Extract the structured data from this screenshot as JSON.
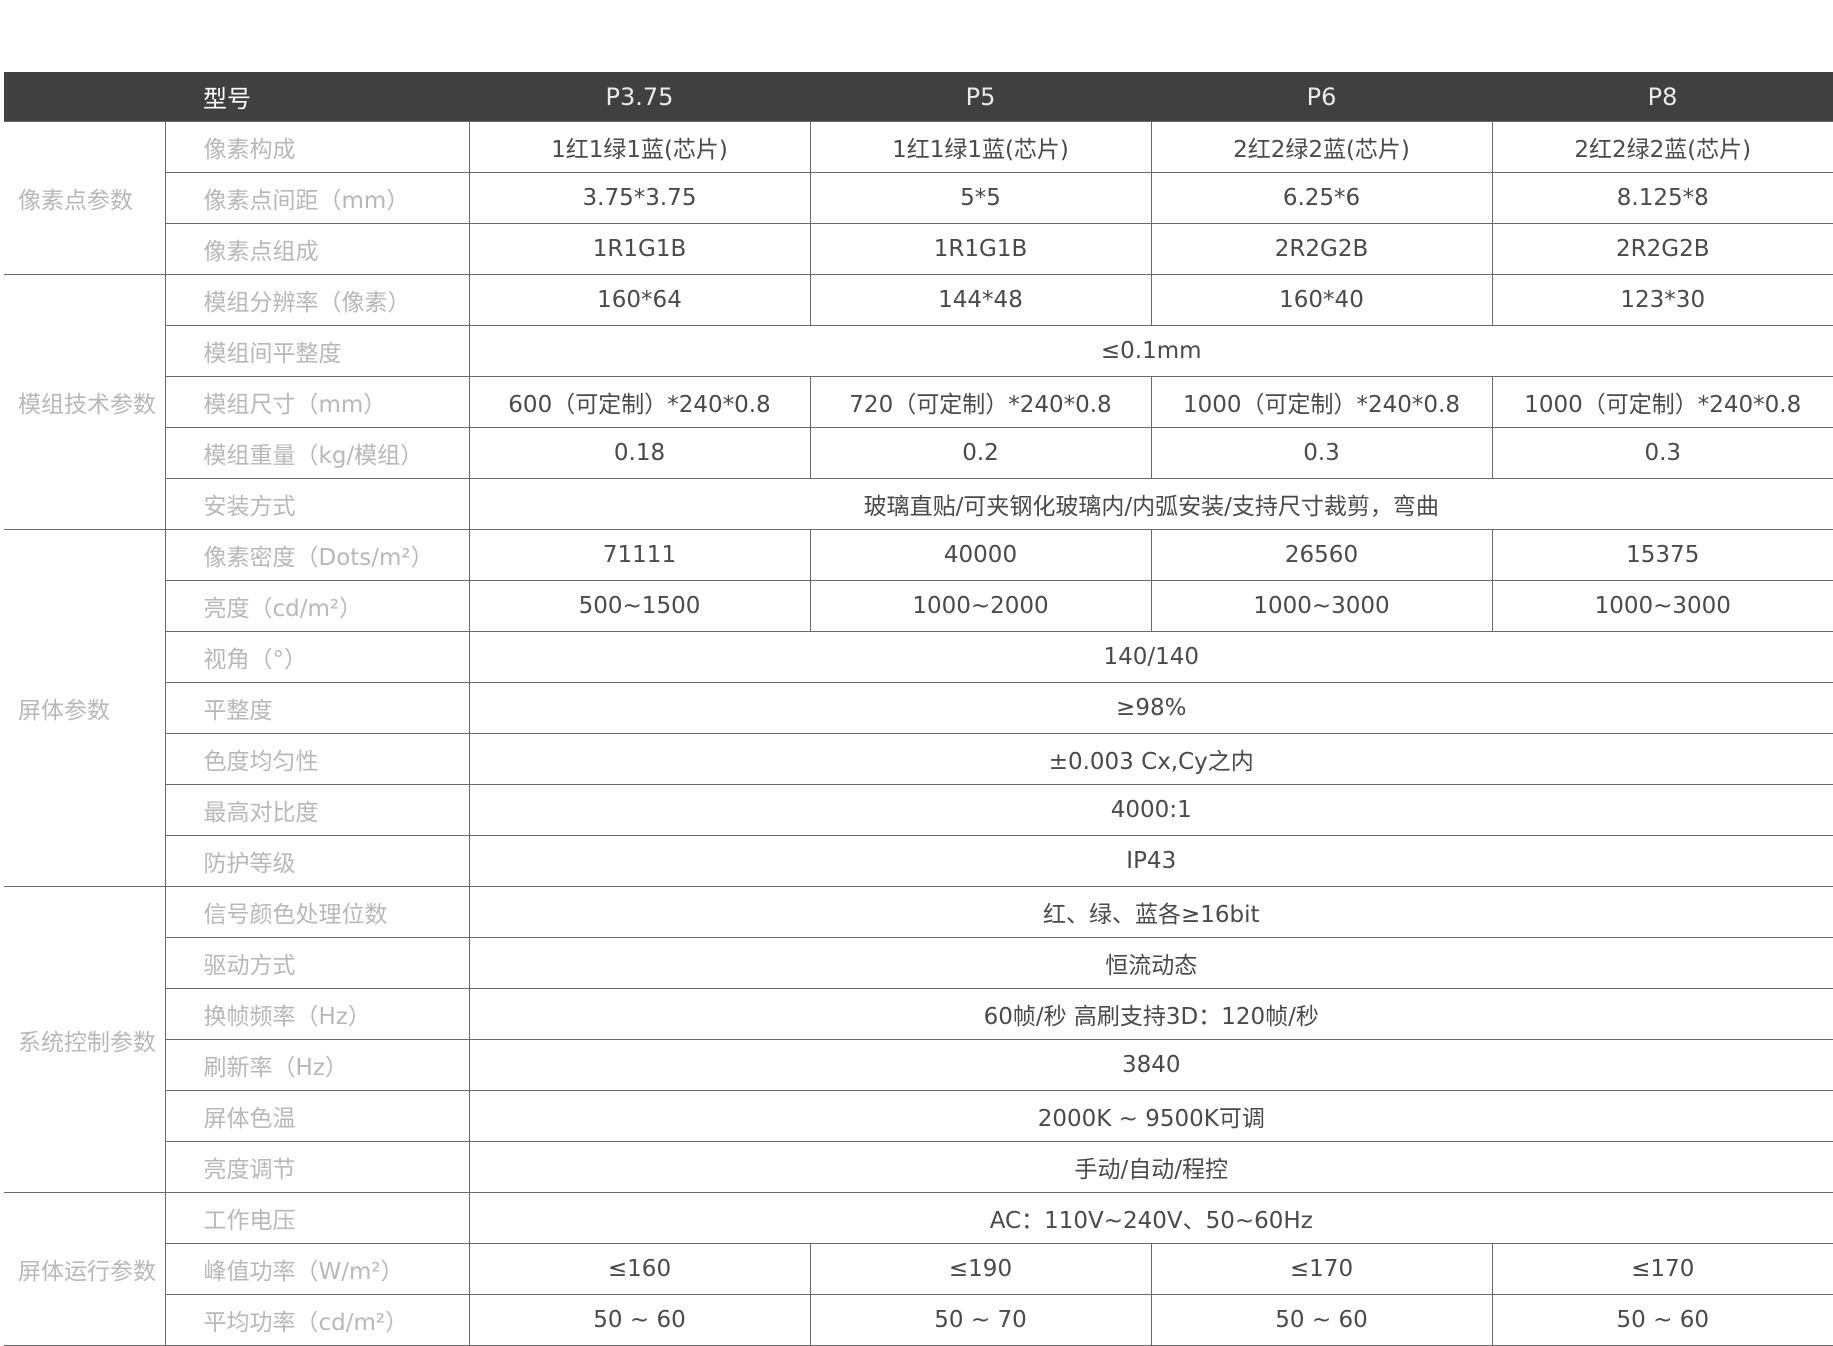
{
  "header": {
    "model_label": "型号",
    "models": [
      "P3.75",
      "P5",
      "P6",
      "P8"
    ]
  },
  "groups": [
    {
      "name": "像素点参数",
      "rows": [
        {
          "param": "像素构成",
          "values": [
            "1红1绿1蓝(芯片)",
            "1红1绿1蓝(芯片)",
            "2红2绿2蓝(芯片)",
            "2红2绿2蓝(芯片)"
          ]
        },
        {
          "param": "像素点间距（mm）",
          "values": [
            "3.75*3.75",
            "5*5",
            "6.25*6",
            "8.125*8"
          ]
        },
        {
          "param": "像素点组成",
          "values": [
            "1R1G1B",
            "1R1G1B",
            "2R2G2B",
            "2R2G2B"
          ]
        }
      ]
    },
    {
      "name": "模组技术参数",
      "rows": [
        {
          "param": "模组分辨率（像素）",
          "values": [
            "160*64",
            "144*48",
            "160*40",
            "123*30"
          ]
        },
        {
          "param": "模组间平整度",
          "merged": "≤0.1mm"
        },
        {
          "param": "模组尺寸（mm）",
          "values": [
            "600（可定制）*240*0.8",
            "720（可定制）*240*0.8",
            "1000（可定制）*240*0.8",
            "1000（可定制）*240*0.8"
          ]
        },
        {
          "param": "模组重量（kg/模组）",
          "values": [
            "0.18",
            "0.2",
            "0.3",
            "0.3"
          ]
        },
        {
          "param": "安装方式",
          "merged": "玻璃直贴/可夹钢化玻璃内/内弧安装/支持尺寸裁剪，弯曲"
        }
      ]
    },
    {
      "name": "屏体参数",
      "rows": [
        {
          "param": "像素密度（Dots/m²）",
          "values": [
            "71111",
            "40000",
            "26560",
            "15375"
          ]
        },
        {
          "param": "亮度（cd/m²）",
          "values": [
            "500~1500",
            "1000~2000",
            "1000~3000",
            "1000~3000"
          ]
        },
        {
          "param": "视角（°）",
          "merged": "140/140"
        },
        {
          "param": "平整度",
          "merged": "≥98%"
        },
        {
          "param": "色度均匀性",
          "merged": "±0.003   Cx,Cy之内"
        },
        {
          "param": "最高对比度",
          "merged": "4000:1"
        },
        {
          "param": "防护等级",
          "merged": "IP43"
        }
      ]
    },
    {
      "name": "系统控制参数",
      "rows": [
        {
          "param": "信号颜色处理位数",
          "merged": "红、绿、蓝各≥16bit"
        },
        {
          "param": "驱动方式",
          "merged": "恒流动态"
        },
        {
          "param": "换帧频率（Hz）",
          "merged": "60帧/秒    高刷支持3D：120帧/秒"
        },
        {
          "param": "刷新率（Hz）",
          "merged": "3840"
        },
        {
          "param": "屏体色温",
          "merged": "2000K ~ 9500K可调"
        },
        {
          "param": "亮度调节",
          "merged": "手动/自动/程控"
        }
      ]
    },
    {
      "name": "屏体运行参数",
      "rows": [
        {
          "param": "工作电压",
          "merged": "AC：110V~240V、50~60Hz"
        },
        {
          "param": "峰值功率（W/m²）",
          "values": [
            "≤160",
            "≤190",
            "≤170",
            "≤170"
          ]
        },
        {
          "param": "平均功率（cd/m²）",
          "values": [
            "50 ~ 60",
            "50 ~ 70",
            "50 ~ 60",
            "50 ~ 60"
          ]
        }
      ]
    }
  ]
}
